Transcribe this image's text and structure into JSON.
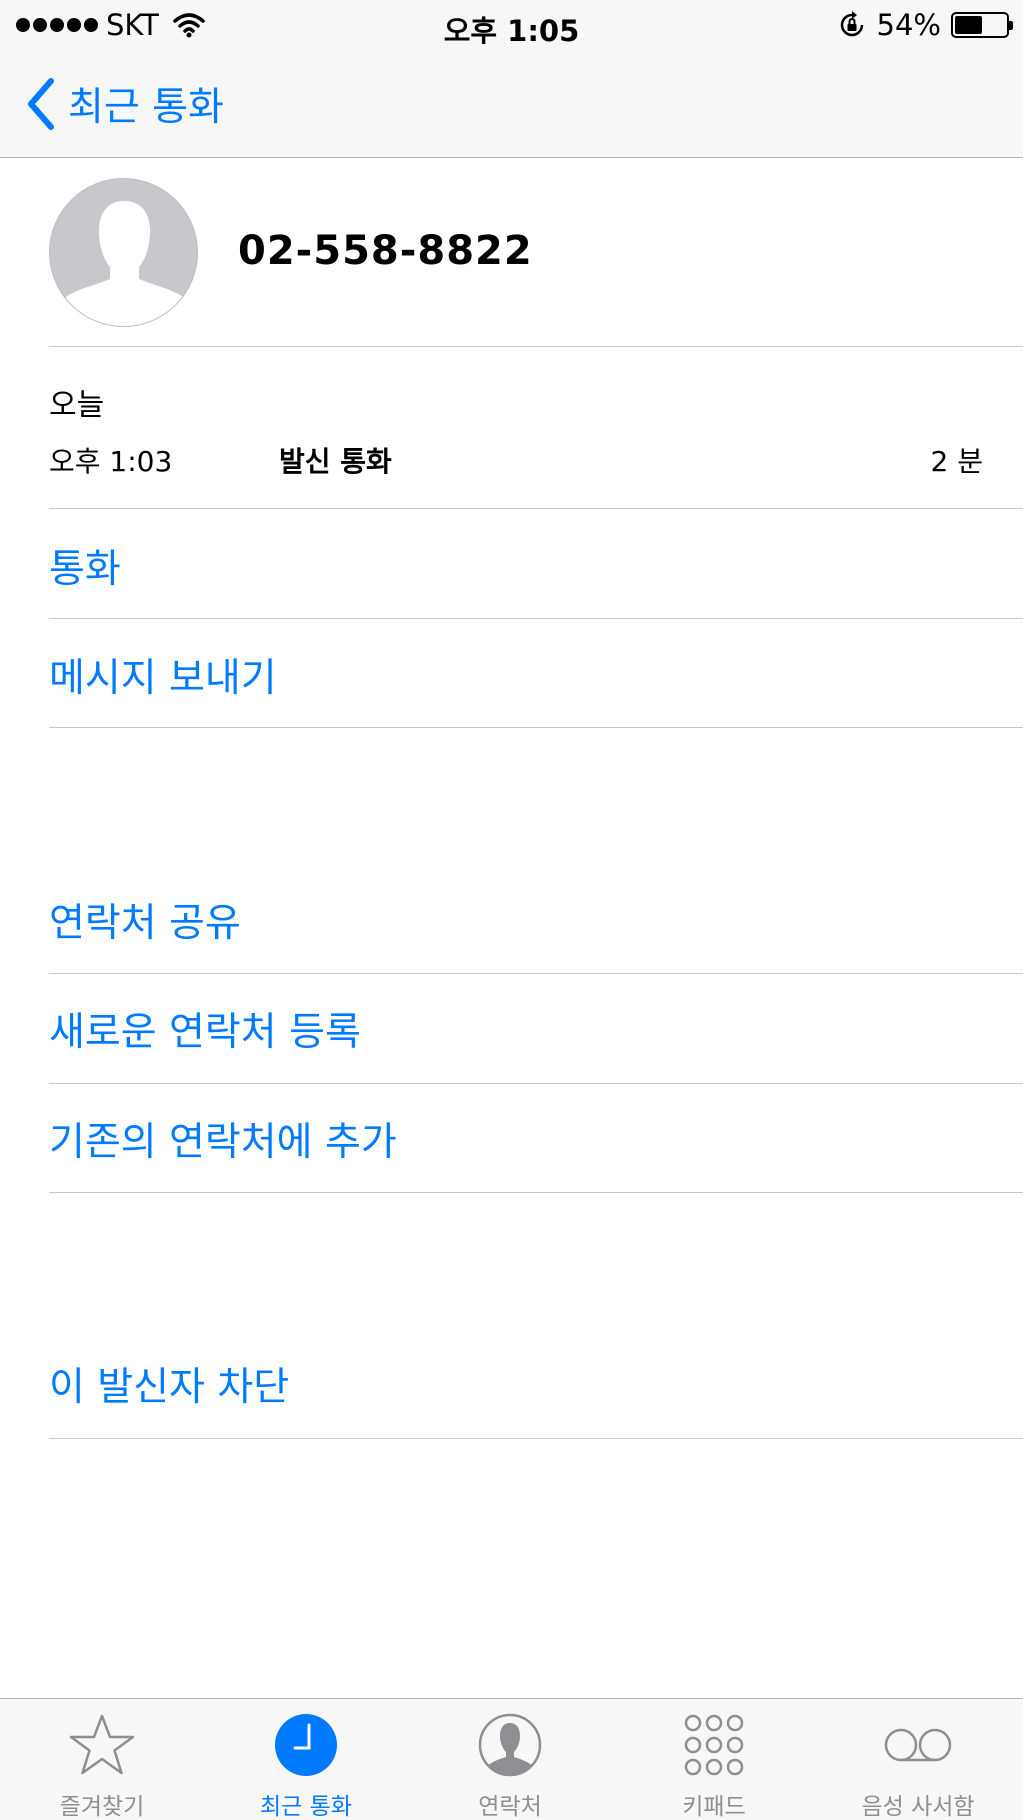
{
  "status_bar": {
    "carrier": "SKT",
    "time": "오후 1:05",
    "battery_percent": "54%",
    "battery_level": 0.54
  },
  "nav": {
    "back_label": "최근 통화"
  },
  "contact": {
    "phone_number": "02-558-8822"
  },
  "call_history": {
    "date": "오늘",
    "entries": [
      {
        "time": "오후 1:03",
        "type": "발신 통화",
        "duration": "2 분"
      }
    ]
  },
  "actions": {
    "call": "통화",
    "send_message": "메시지 보내기",
    "share_contact": "연락처 공유",
    "create_contact": "새로운 연락처 등록",
    "add_to_existing": "기존의 연락처에 추가",
    "block_caller": "이 발신자 차단"
  },
  "tab_bar": {
    "tabs": [
      {
        "label": "즐겨찾기",
        "icon": "star-icon",
        "active": false
      },
      {
        "label": "최근 통화",
        "icon": "clock-icon",
        "active": true
      },
      {
        "label": "연락처",
        "icon": "contacts-icon",
        "active": false
      },
      {
        "label": "키패드",
        "icon": "keypad-icon",
        "active": false
      },
      {
        "label": "음성 사서함",
        "icon": "voicemail-icon",
        "active": false
      }
    ]
  },
  "colors": {
    "accent": "#007aff",
    "inactive": "#8e8e93",
    "bar_background": "#f7f7f7"
  }
}
